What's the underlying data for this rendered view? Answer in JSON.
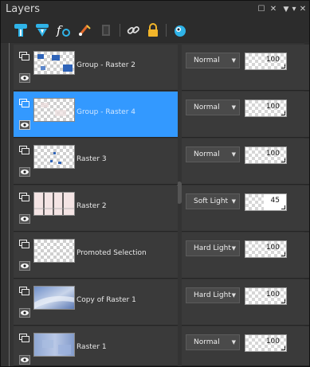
{
  "panel": {
    "title": "Layers"
  },
  "title_buttons": [
    {
      "name": "maximize-icon",
      "glyph": "☐"
    },
    {
      "name": "close-icon",
      "glyph": "✕"
    },
    {
      "name": "pin-icon",
      "glyph": "📌"
    },
    {
      "name": "menu-chevron-icon",
      "glyph": "▾"
    },
    {
      "name": "panel-close-icon",
      "glyph": "✕"
    }
  ],
  "toolbar": {
    "tools": [
      "new-raster-layer-icon",
      "new-vector-layer-icon",
      "layer-effects-icon",
      "brush-mask-icon",
      "duplicate-layer-icon",
      "link-layers-icon",
      "lock-transparency-icon",
      "layer-palette-menu-icon"
    ]
  },
  "layers": [
    {
      "name": "Group - Raster 2",
      "blend": "Normal",
      "opacity": "100",
      "selected": false
    },
    {
      "name": "Group - Raster 4",
      "blend": "Normal",
      "opacity": "100",
      "selected": true
    },
    {
      "name": "Raster 3",
      "blend": "Normal",
      "opacity": "100",
      "selected": false
    },
    {
      "name": "Raster 2",
      "blend": "Soft Light",
      "opacity": "45",
      "selected": false
    },
    {
      "name": "Promoted Selection",
      "blend": "Hard Light",
      "opacity": "100",
      "selected": false
    },
    {
      "name": "Copy of Raster 1",
      "blend": "Hard Light",
      "opacity": "100",
      "selected": false
    },
    {
      "name": "Raster 1",
      "blend": "Normal",
      "opacity": "100",
      "selected": false
    }
  ],
  "colors": {
    "selection": "#3399ff",
    "row": "#3a3a3a",
    "panel": "#2a2a2a"
  }
}
